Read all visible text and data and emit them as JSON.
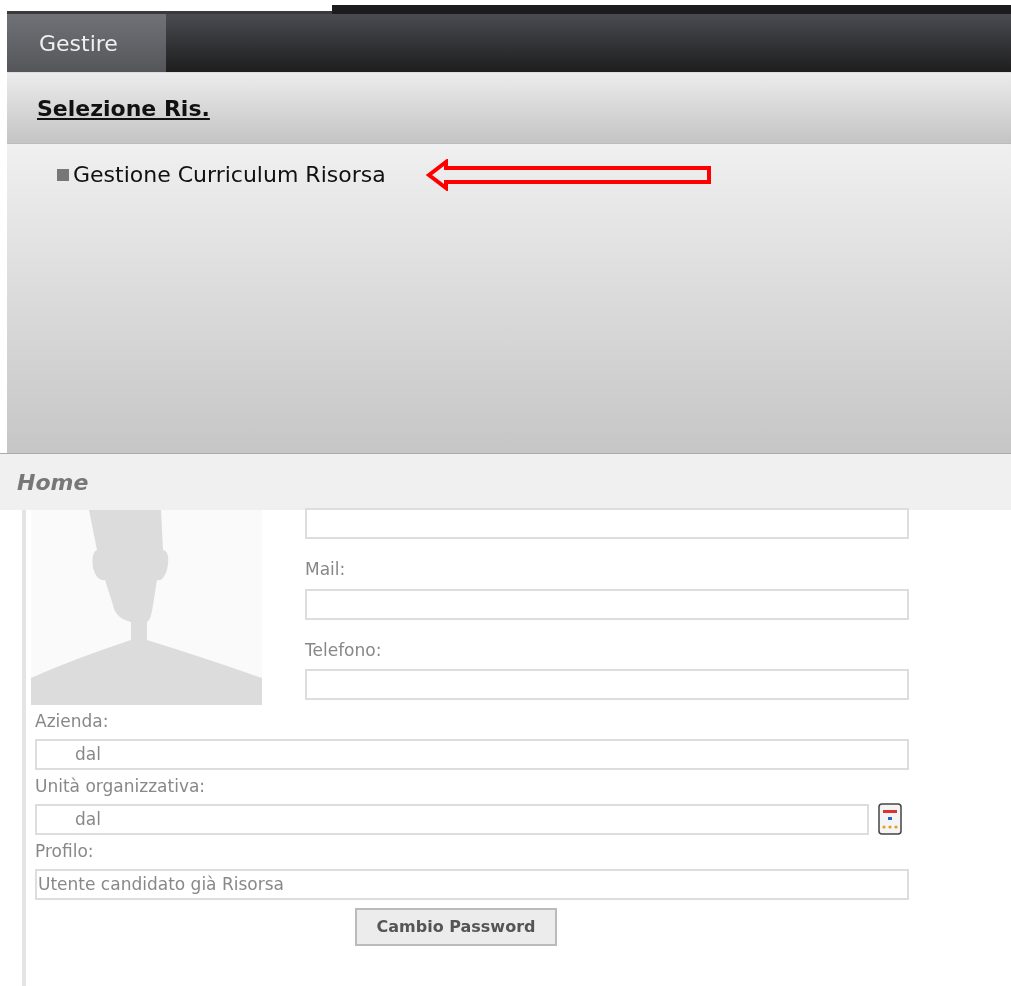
{
  "menu_bar": {
    "tabs": [
      {
        "label": "Gestire",
        "selected": true
      }
    ]
  },
  "section": {
    "title": "Selezione Ris.",
    "items": [
      {
        "label": "Gestione Curriculum Risorsa"
      }
    ]
  },
  "breadcrumb": "Home",
  "form": {
    "side_fields": [
      {
        "kind": "bare"
      },
      {
        "kind": "labelled",
        "label": "Mail:"
      },
      {
        "kind": "labelled",
        "label": "Telefono:"
      }
    ],
    "fields": [
      {
        "label": "Azienda:",
        "value": "dal",
        "kind": "text"
      },
      {
        "label": "Unità organizzativa:",
        "value": "dal",
        "kind": "picker"
      },
      {
        "label": "Profilo:",
        "value": "Utente candidato già Risorsa",
        "kind": "text"
      }
    ],
    "button": "Cambio Password"
  }
}
